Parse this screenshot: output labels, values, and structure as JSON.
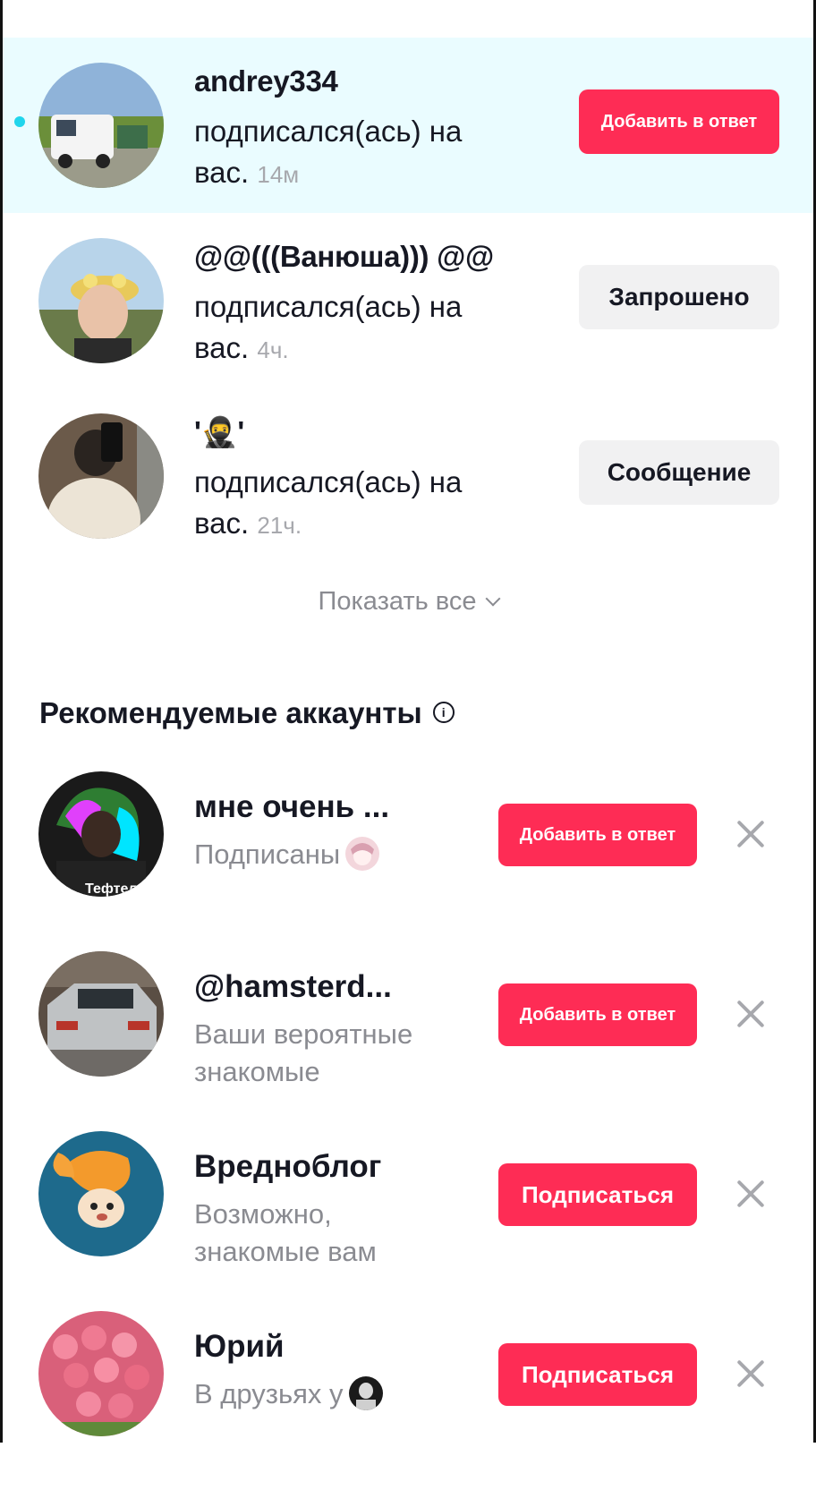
{
  "notifications": [
    {
      "name": "andrey334",
      "action": "подписался(ась) на вас.",
      "time": "14м",
      "button": "Добавить в ответ",
      "avatar_icon": "white-van-photo"
    },
    {
      "name": "@@(((Ванюша))) @@",
      "action": "подписался(ась) на вас.",
      "time": "4ч.",
      "button": "Запрошено",
      "avatar_icon": "person-flower-crown-photo"
    },
    {
      "name": "'🥷'",
      "action": "подписался(ась) на вас.",
      "time": "21ч.",
      "button": "Сообщение",
      "avatar_icon": "mirror-selfie-photo"
    }
  ],
  "show_all_label": "Показать все",
  "section_title": "Рекомендуемые аккаунты",
  "recommended": [
    {
      "name": "мне очень ...",
      "subtitle": "Подписаны",
      "button": "Добавить в ответ",
      "avatar_text": "Тефтел",
      "avatar_icon": "neon-character-art"
    },
    {
      "name": "@hamsterd...",
      "subtitle": "Ваши вероятные знакомые",
      "button": "Добавить в ответ",
      "avatar_icon": "silver-car-photo"
    },
    {
      "name": "Вредноблог",
      "subtitle": "Возможно, знакомые вам",
      "button": "Подписаться",
      "avatar_icon": "orange-hair-doll"
    },
    {
      "name": "Юрий",
      "subtitle": "В друзьях у",
      "button": "Подписаться",
      "avatar_icon": "pink-roses-photo"
    }
  ],
  "colors": {
    "accent": "#fe2c55",
    "highlight": "#eafcff",
    "unread_dot": "#20d5ec"
  }
}
